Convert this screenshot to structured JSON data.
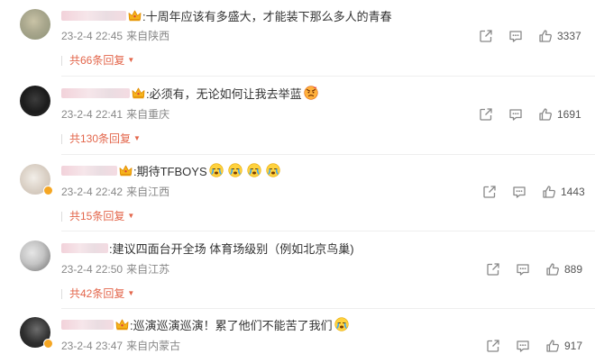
{
  "comments": [
    {
      "text": ":十周年应该有多盛大，才能装下那么多人的青春",
      "date": "23-2-4 22:45",
      "location": "来自陕西",
      "likes": "3337",
      "replies": "共66条回复"
    },
    {
      "text": ":必须有，无论如何让我去举蓝",
      "date": "23-2-4 22:41",
      "location": "来自重庆",
      "likes": "1691",
      "replies": "共130条回复"
    },
    {
      "text": ":期待TFBOYS",
      "date": "23-2-4 22:42",
      "location": "来自江西",
      "likes": "1443",
      "replies": "共15条回复"
    },
    {
      "text": ":建议四面台开全场 体育场级别（例如北京鸟巢)",
      "date": "23-2-4 22:50",
      "location": "来自江苏",
      "likes": "889",
      "replies": "共42条回复"
    },
    {
      "text": ":巡演巡演巡演！累了他们不能苦了我们",
      "date": "23-2-4 23:47",
      "location": "来自内蒙古",
      "likes": "917"
    }
  ],
  "colors": {
    "accent": "#e3664b",
    "meta": "#888888",
    "crown": "#f5a623"
  },
  "icons": [
    "share-icon",
    "comment-icon",
    "thumbs-up-icon",
    "crown-icon",
    "crying-emoji-icon",
    "angry-emoji-icon",
    "chevron-down-icon"
  ]
}
